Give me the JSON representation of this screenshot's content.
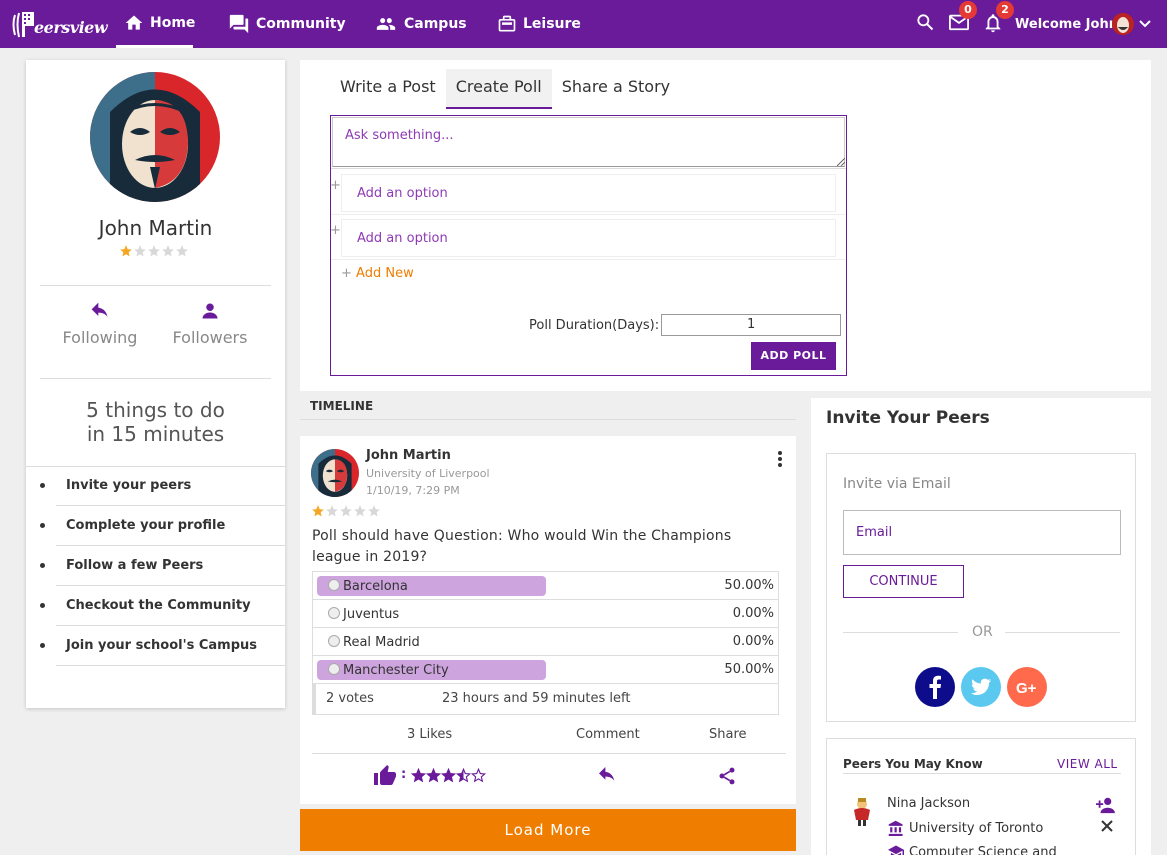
{
  "nav": {
    "logo_text": "eersview",
    "items": [
      {
        "label": "Home",
        "icon": "home-icon"
      },
      {
        "label": "Community",
        "icon": "chat-icon"
      },
      {
        "label": "Campus",
        "icon": "people-icon"
      },
      {
        "label": "Leisure",
        "icon": "briefcase-icon"
      }
    ],
    "mail_count": "0",
    "notif_count": "2",
    "welcome": "Welcome John"
  },
  "profile": {
    "name": "John Martin",
    "rating": 1,
    "following_label": "Following",
    "followers_label": "Followers",
    "todo_title_line1": "5 things to do",
    "todo_title_line2": "in 15 minutes",
    "todo_items": [
      "Invite your peers",
      "Complete your profile",
      "Follow a few Peers",
      "Checkout the Community",
      "Join your school's Campus"
    ]
  },
  "composer": {
    "tabs": [
      "Write a Post",
      "Create Poll",
      "Share a Story"
    ],
    "active_tab": "Create Poll",
    "ask_placeholder": "Ask something...",
    "option_placeholder_1": "Add an option",
    "option_placeholder_2": "Add an option",
    "add_new": "Add New",
    "duration_label": "Poll Duration(Days):",
    "duration_value": "1",
    "add_poll_label": "ADD POLL"
  },
  "timeline": {
    "header": "TIMELINE",
    "post": {
      "author": "John Martin",
      "school": "University of Liverpool",
      "timestamp": "1/10/19, 7:29 PM",
      "rating": 1,
      "question": "Poll should have Question: Who would Win the Champions league in 2019?",
      "options": [
        {
          "label": "Barcelona",
          "percent": "50.00%",
          "value": 50
        },
        {
          "label": "Juventus",
          "percent": "0.00%",
          "value": 0
        },
        {
          "label": "Real Madrid",
          "percent": "0.00%",
          "value": 0
        },
        {
          "label": "Manchester City",
          "percent": "50.00%",
          "value": 50
        }
      ],
      "votes": "2 votes",
      "time_left": "23 hours and 59 minutes left",
      "likes": "3 Likes",
      "comment_label": "Comment",
      "share_label": "Share",
      "like_separator": ":",
      "reaction_rating": 3.5
    },
    "load_more": "Load More"
  },
  "invite": {
    "title": "Invite Your Peers",
    "via_email": "Invite via Email",
    "email_placeholder": "Email",
    "continue": "CONTINUE",
    "or": "OR",
    "social": [
      "facebook-icon",
      "twitter-icon",
      "google-plus-icon"
    ],
    "social_colors": {
      "facebook": "#0d0d8c",
      "twitter": "#5bc8f0",
      "google": "#ff6a4d"
    }
  },
  "peers": {
    "title": "Peers You May Know",
    "view_all": "VIEW ALL",
    "person": {
      "name": "Nina Jackson",
      "school": "University of Toronto",
      "program": "Computer Science and"
    }
  },
  "colors": {
    "brand": "#6a1b9a",
    "accent": "#ef7d00",
    "star": "#f5a623"
  }
}
